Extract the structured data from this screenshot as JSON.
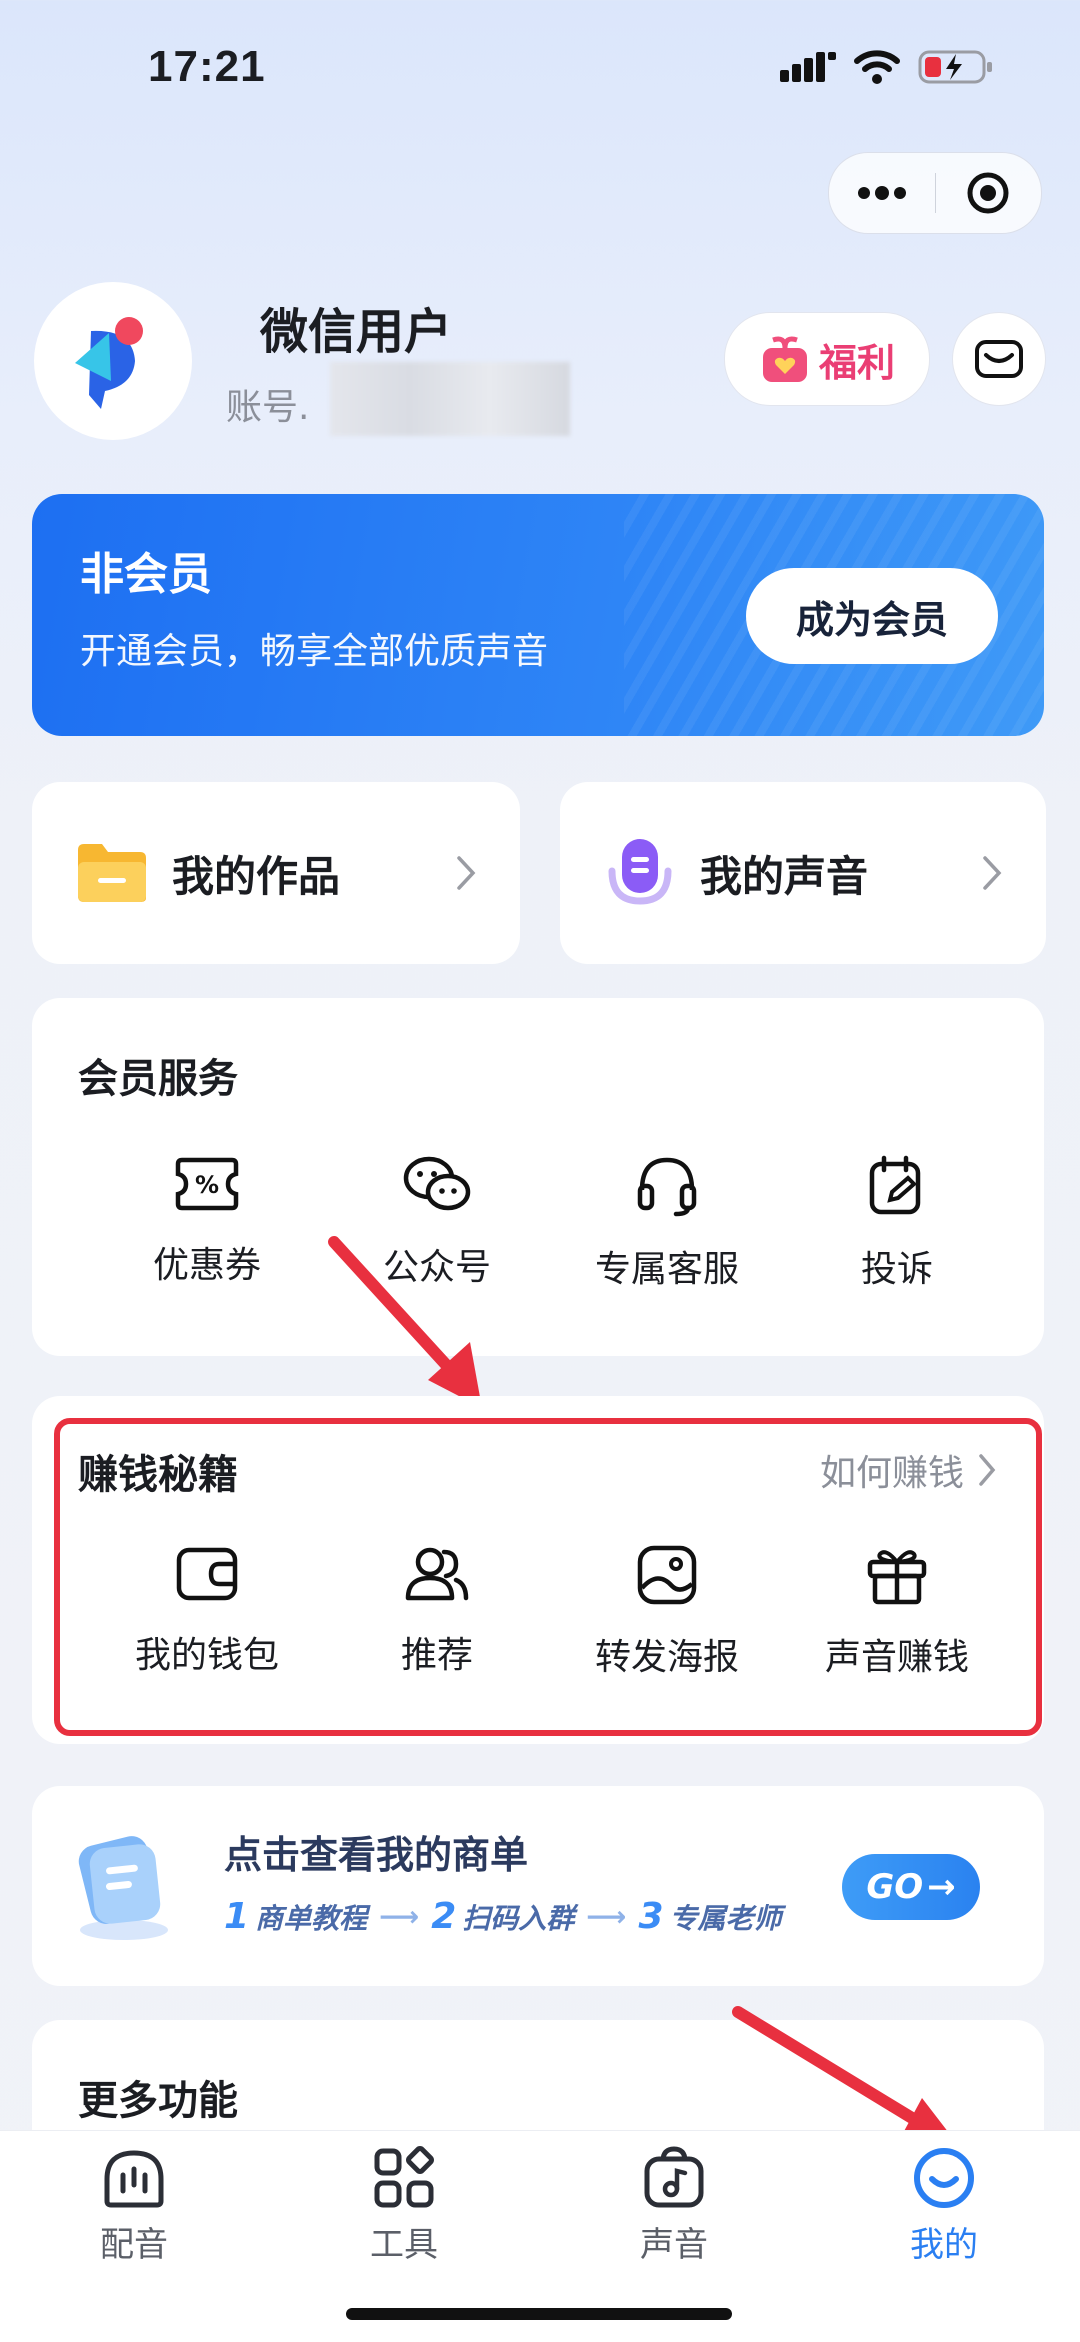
{
  "status_bar": {
    "time": "17:21"
  },
  "profile": {
    "username": "微信用户",
    "account_label": "账号."
  },
  "header_buttons": {
    "fuli_label": "福利"
  },
  "member_banner": {
    "title": "非会员",
    "subtitle": "开通会员，畅享全部优质声音",
    "button_label": "成为会员"
  },
  "quick_links": [
    {
      "label": "我的作品",
      "icon": "folder-icon"
    },
    {
      "label": "我的声音",
      "icon": "microphone-icon"
    }
  ],
  "member_services": {
    "title": "会员服务",
    "items": [
      {
        "label": "优惠券",
        "icon": "coupon-icon"
      },
      {
        "label": "公众号",
        "icon": "wechat-icon"
      },
      {
        "label": "专属客服",
        "icon": "headset-icon"
      },
      {
        "label": "投诉",
        "icon": "complaint-icon"
      }
    ]
  },
  "earn_money": {
    "title": "赚钱秘籍",
    "link_label": "如何赚钱",
    "items": [
      {
        "label": "我的钱包",
        "icon": "wallet-icon"
      },
      {
        "label": "推荐",
        "icon": "users-icon"
      },
      {
        "label": "转发海报",
        "icon": "poster-icon"
      },
      {
        "label": "声音赚钱",
        "icon": "gift-icon"
      }
    ]
  },
  "business_card": {
    "title": "点击查看我的商单",
    "steps": [
      {
        "num": "1",
        "label": "商单教程"
      },
      {
        "num": "2",
        "label": "扫码入群"
      },
      {
        "num": "3",
        "label": "专属老师"
      }
    ],
    "go_label": "GO"
  },
  "more": {
    "title": "更多功能"
  },
  "bottom_nav": {
    "items": [
      {
        "label": "配音",
        "icon": "dubbing-icon",
        "active": false
      },
      {
        "label": "工具",
        "icon": "tools-icon",
        "active": false
      },
      {
        "label": "声音",
        "icon": "voice-bag-icon",
        "active": false
      },
      {
        "label": "我的",
        "icon": "smile-icon",
        "active": true
      }
    ]
  },
  "colors": {
    "accent": "#2a7ff2",
    "banner": "#1d6ff2",
    "highlight_box": "#e8303f",
    "fuli": "#ea3e74"
  }
}
